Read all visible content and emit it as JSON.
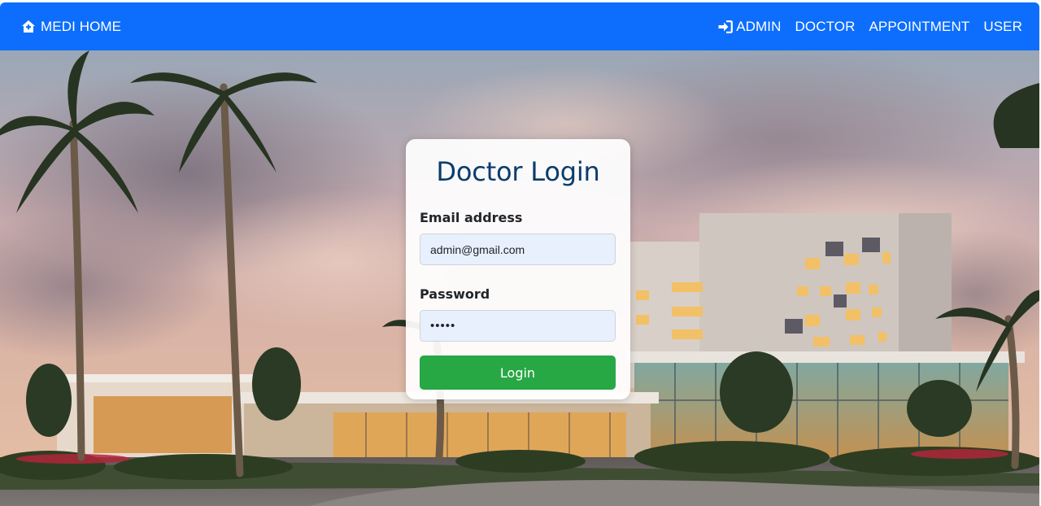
{
  "navbar": {
    "brand": {
      "label": "MEDI HOME",
      "icon": "home-icon"
    },
    "links": [
      {
        "label": "ADMIN",
        "icon": "sign-in-icon"
      },
      {
        "label": "DOCTOR"
      },
      {
        "label": "APPOINTMENT"
      },
      {
        "label": "USER"
      }
    ]
  },
  "login": {
    "title": "Doctor Login",
    "email_label": "Email address",
    "email_value": "admin@gmail.com",
    "password_label": "Password",
    "password_value": "12345",
    "button_label": "Login"
  },
  "colors": {
    "navbar": "#0d6efd",
    "title": "#0b3c6b",
    "button": "#28a745",
    "input_bg": "#e8f0fe"
  }
}
